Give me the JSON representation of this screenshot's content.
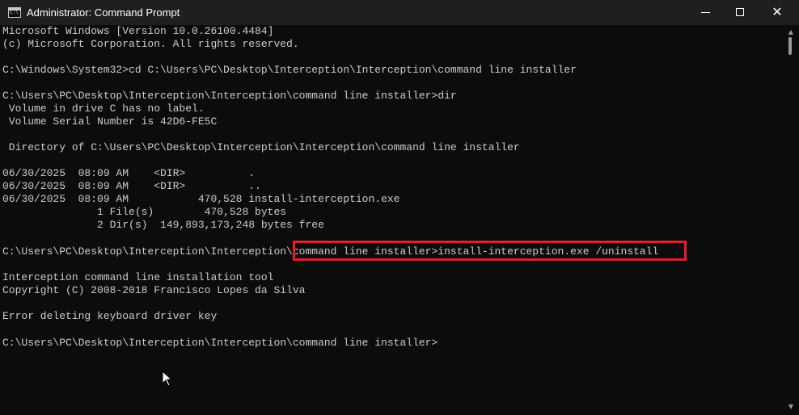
{
  "window": {
    "title": "Administrator: Command Prompt",
    "app_icon_text": "C:\\"
  },
  "console": {
    "lines": [
      "Microsoft Windows [Version 10.0.26100.4484]",
      "(c) Microsoft Corporation. All rights reserved.",
      "",
      "C:\\Windows\\System32>cd C:\\Users\\PC\\Desktop\\Interception\\Interception\\command line installer",
      "",
      "C:\\Users\\PC\\Desktop\\Interception\\Interception\\command line installer>dir",
      " Volume in drive C has no label.",
      " Volume Serial Number is 42D6-FE5C",
      "",
      " Directory of C:\\Users\\PC\\Desktop\\Interception\\Interception\\command line installer",
      "",
      "06/30/2025  08:09 AM    <DIR>          .",
      "06/30/2025  08:09 AM    <DIR>          ..",
      "06/30/2025  08:09 AM           470,528 install-interception.exe",
      "               1 File(s)        470,528 bytes",
      "               2 Dir(s)  149,893,173,248 bytes free",
      "",
      "C:\\Users\\PC\\Desktop\\Interception\\Interception\\command line installer>install-interception.exe /uninstall",
      "",
      "Interception command line installation tool",
      "Copyright (C) 2008-2018 Francisco Lopes da Silva",
      "",
      "Error deleting keyboard driver key",
      "",
      "C:\\Users\\PC\\Desktop\\Interception\\Interception\\command line installer>"
    ]
  },
  "colors": {
    "background": "#0c0c0c",
    "titlebar": "#1f1f1f",
    "text": "#cccccc",
    "highlight_box": "#e0202a"
  },
  "icons": {
    "minimize": "minimize-icon",
    "maximize": "maximize-icon",
    "close": "close-icon",
    "cursor": "mouse-pointer-icon"
  }
}
